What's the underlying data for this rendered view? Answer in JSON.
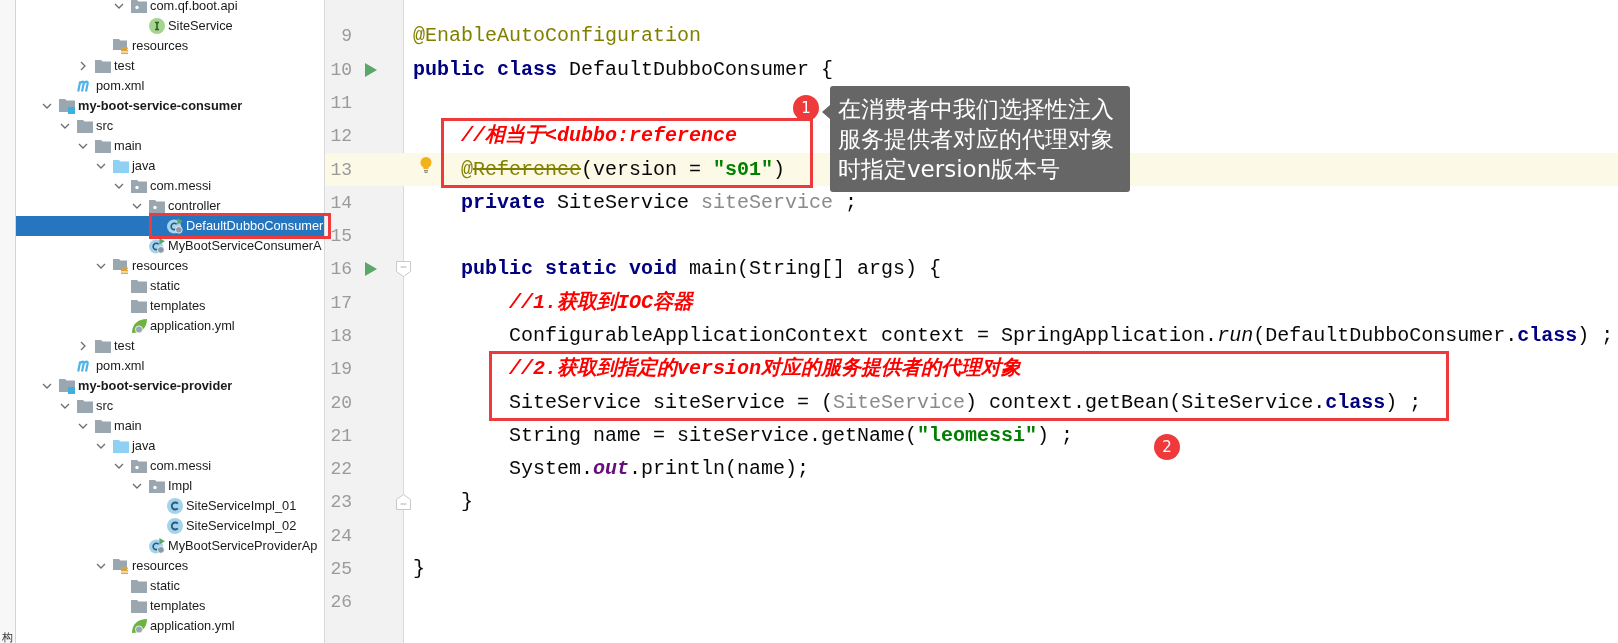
{
  "side_tab": {
    "label": "构"
  },
  "project_tree": [
    {
      "children": [
        {
          "children": [
            {
              "children": [
                {
                  "children": [
                    {
                      "label": "com.qf.boot.api",
                      "kind": "package",
                      "expanded": true,
                      "selected": false,
                      "highlighted": false,
                      "children": [
                        {
                          "label": "SiteService",
                          "kind": "interface",
                          "selected": false,
                          "highlighted": false
                        }
                      ]
                    }
                  ]
                },
                {
                  "label": "resources",
                  "kind": "resources",
                  "selected": false,
                  "highlighted": false
                }
              ]
            },
            {
              "label": "test",
              "kind": "folder",
              "expanded": false,
              "selected": false,
              "highlighted": false
            }
          ]
        },
        {
          "label": "pom.xml",
          "kind": "maven",
          "selected": false,
          "highlighted": false
        }
      ]
    },
    {
      "label": "my-boot-service-consumer",
      "kind": "module",
      "expanded": true,
      "selected": false,
      "highlighted": false,
      "children": [
        {
          "label": "src",
          "kind": "folder",
          "expanded": true,
          "selected": false,
          "highlighted": false,
          "children": [
            {
              "label": "main",
              "kind": "folder",
              "expanded": true,
              "selected": false,
              "highlighted": false,
              "children": [
                {
                  "label": "java",
                  "kind": "source",
                  "expanded": true,
                  "selected": false,
                  "highlighted": false,
                  "children": [
                    {
                      "label": "com.messi",
                      "kind": "package",
                      "expanded": true,
                      "selected": false,
                      "highlighted": false,
                      "children": [
                        {
                          "label": "controller",
                          "kind": "package",
                          "expanded": true,
                          "selected": false,
                          "highlighted": false,
                          "children": [
                            {
                              "label": "DefaultDubboConsumer",
                              "kind": "runnable-class",
                              "selected": true,
                              "highlighted": true
                            }
                          ]
                        },
                        {
                          "label": "MyBootServiceConsumerA",
                          "kind": "runnable-class",
                          "selected": false,
                          "highlighted": false
                        }
                      ]
                    }
                  ]
                },
                {
                  "label": "resources",
                  "kind": "resources",
                  "expanded": true,
                  "selected": false,
                  "highlighted": false,
                  "children": [
                    {
                      "label": "static",
                      "kind": "folder",
                      "selected": false,
                      "highlighted": false
                    },
                    {
                      "label": "templates",
                      "kind": "folder",
                      "selected": false,
                      "highlighted": false
                    },
                    {
                      "label": "application.yml",
                      "kind": "yaml",
                      "selected": false,
                      "highlighted": false
                    }
                  ]
                }
              ]
            },
            {
              "label": "test",
              "kind": "folder",
              "expanded": false,
              "selected": false,
              "highlighted": false
            }
          ]
        },
        {
          "label": "pom.xml",
          "kind": "maven",
          "selected": false,
          "highlighted": false
        }
      ]
    },
    {
      "label": "my-boot-service-provider",
      "kind": "module",
      "expanded": true,
      "selected": false,
      "highlighted": false,
      "children": [
        {
          "label": "src",
          "kind": "folder",
          "expanded": true,
          "selected": false,
          "highlighted": false,
          "children": [
            {
              "label": "main",
              "kind": "folder",
              "expanded": true,
              "selected": false,
              "highlighted": false,
              "children": [
                {
                  "label": "java",
                  "kind": "source",
                  "expanded": true,
                  "selected": false,
                  "highlighted": false,
                  "children": [
                    {
                      "label": "com.messi",
                      "kind": "package",
                      "expanded": true,
                      "selected": false,
                      "highlighted": false,
                      "children": [
                        {
                          "label": "Impl",
                          "kind": "package",
                          "expanded": true,
                          "selected": false,
                          "highlighted": false,
                          "children": [
                            {
                              "label": "SiteServiceImpl_01",
                              "kind": "class",
                              "selected": false,
                              "highlighted": false
                            },
                            {
                              "label": "SiteServiceImpl_02",
                              "kind": "class",
                              "selected": false,
                              "highlighted": false
                            }
                          ]
                        },
                        {
                          "label": "MyBootServiceProviderAp",
                          "kind": "runnable-class",
                          "selected": false,
                          "highlighted": false
                        }
                      ]
                    }
                  ]
                },
                {
                  "label": "resources",
                  "kind": "resources",
                  "expanded": true,
                  "selected": false,
                  "highlighted": false,
                  "children": [
                    {
                      "label": "static",
                      "kind": "folder",
                      "selected": false,
                      "highlighted": false
                    },
                    {
                      "label": "templates",
                      "kind": "folder",
                      "selected": false,
                      "highlighted": false
                    },
                    {
                      "label": "application.yml",
                      "kind": "yaml",
                      "selected": false,
                      "highlighted": false
                    }
                  ]
                }
              ]
            }
          ]
        }
      ]
    }
  ],
  "editor": {
    "lines": [
      {
        "number": "9",
        "current": false,
        "highlighted": false,
        "tokens": [
          {
            "kind": "annotation",
            "text": "@EnableAutoConfiguration"
          }
        ]
      },
      {
        "number": "10",
        "current": false,
        "highlighted": false,
        "icons": [
          {
            "kind": "run"
          }
        ],
        "tokens": [
          {
            "kind": "keyword",
            "text": "public"
          },
          {
            "kind": "keyword",
            "text": " class"
          },
          {
            "kind": "plain",
            "text": " DefaultDubboConsumer {"
          }
        ]
      },
      {
        "number": "11",
        "current": false,
        "highlighted": false
      },
      {
        "number": "12",
        "current": false,
        "highlighted": true,
        "tokens": [
          {
            "kind": "comment",
            "text": "    //相当于<dubbo:reference"
          }
        ]
      },
      {
        "number": "13",
        "current": true,
        "highlighted": true,
        "icons": [
          {
            "kind": "bulb"
          }
        ],
        "tokens": [
          {
            "kind": "annotation",
            "text": "    @"
          },
          {
            "kind": "deprecated",
            "text": "Reference"
          },
          {
            "kind": "plain",
            "text": "(version = "
          },
          {
            "kind": "string",
            "text": "\"s01\""
          },
          {
            "kind": "plain",
            "text": ")"
          }
        ]
      },
      {
        "number": "14",
        "current": false,
        "highlighted": false,
        "tokens": [
          {
            "kind": "keyword",
            "text": "    private"
          },
          {
            "kind": "plain",
            "text": " SiteService "
          },
          {
            "kind": "unused",
            "text": "siteService"
          },
          {
            "kind": "plain",
            "text": " ;"
          }
        ]
      },
      {
        "number": "15",
        "current": false,
        "highlighted": false
      },
      {
        "number": "16",
        "current": false,
        "highlighted": false,
        "icons": [
          {
            "kind": "run"
          },
          {
            "kind": "fold-start"
          }
        ],
        "tokens": [
          {
            "kind": "keyword",
            "text": "    public"
          },
          {
            "kind": "keyword",
            "text": " static"
          },
          {
            "kind": "keyword",
            "text": " void"
          },
          {
            "kind": "plain",
            "text": " main(String[] args) {"
          }
        ]
      },
      {
        "number": "17",
        "current": false,
        "highlighted": false,
        "tokens": [
          {
            "kind": "comment",
            "text": "        //1.获取到IOC容器"
          }
        ]
      },
      {
        "number": "18",
        "current": false,
        "highlighted": false,
        "tokens": [
          {
            "kind": "plain",
            "text": "        ConfigurableApplicationContext context = SpringApplication."
          },
          {
            "kind": "static-call",
            "text": "run"
          },
          {
            "kind": "plain",
            "text": "(DefaultDubboConsumer."
          },
          {
            "kind": "keyword",
            "text": "class"
          },
          {
            "kind": "plain",
            "text": ") ;"
          }
        ]
      },
      {
        "number": "19",
        "current": false,
        "highlighted": true,
        "tokens": [
          {
            "kind": "comment",
            "text": "        //2.获取到指定的version对应的服务提供者的代理对象"
          }
        ]
      },
      {
        "number": "20",
        "current": false,
        "highlighted": true,
        "tokens": [
          {
            "kind": "plain",
            "text": "        SiteService siteService = ("
          },
          {
            "kind": "unused",
            "text": "SiteService"
          },
          {
            "kind": "plain",
            "text": ") context.getBean(SiteService."
          },
          {
            "kind": "keyword",
            "text": "class"
          },
          {
            "kind": "plain",
            "text": ") ;"
          }
        ]
      },
      {
        "number": "21",
        "current": false,
        "highlighted": false,
        "tokens": [
          {
            "kind": "plain",
            "text": "        String name = siteService.getName("
          },
          {
            "kind": "string",
            "text": "\"leomessi\""
          },
          {
            "kind": "plain",
            "text": ") ;"
          }
        ]
      },
      {
        "number": "22",
        "current": false,
        "highlighted": false,
        "tokens": [
          {
            "kind": "plain",
            "text": "        System."
          },
          {
            "kind": "static-field",
            "text": "out"
          },
          {
            "kind": "plain",
            "text": ".println(name);"
          }
        ]
      },
      {
        "number": "23",
        "current": false,
        "highlighted": false,
        "icons": [
          {
            "kind": "fold-end"
          }
        ],
        "tokens": [
          {
            "kind": "plain",
            "text": "    }"
          }
        ]
      },
      {
        "number": "24",
        "current": false,
        "highlighted": false
      },
      {
        "number": "25",
        "current": false,
        "highlighted": false,
        "tokens": [
          {
            "kind": "plain",
            "text": "}"
          }
        ]
      },
      {
        "number": "26",
        "current": false,
        "highlighted": false
      }
    ]
  },
  "callouts": [
    {
      "number": "1",
      "note": "在消费者中我们选择性注入服务提供者对应的代理对象时指定version版本号"
    },
    {
      "number": "2"
    }
  ]
}
